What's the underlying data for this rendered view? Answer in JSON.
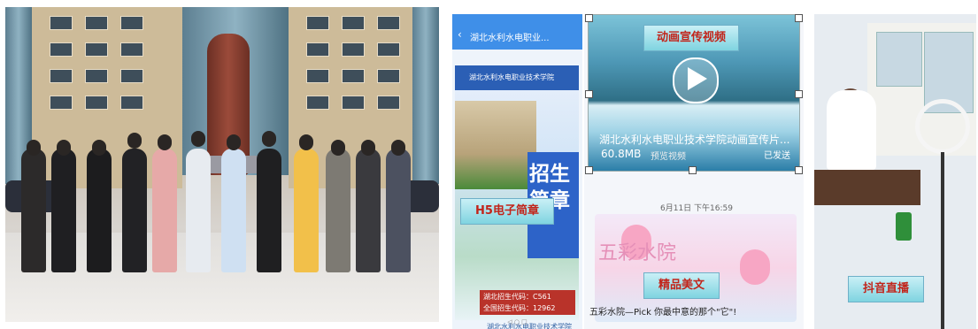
{
  "phone": {
    "title": "湖北水利水电职业...",
    "back_icon": "chevron-left-icon",
    "poster_header": "湖北水利水电职业技术学院",
    "poster_big_text": "招生简章",
    "codes_line1": "湖北招生代码：C561",
    "codes_line2": "全国招生代码：12962",
    "school_name": "湖北水利水电职业技术学院",
    "nav": "◁   ○   □"
  },
  "badges": {
    "h5": "H5电子简章",
    "video": "动画宣传视频",
    "article": "精品美文",
    "douyin": "抖音直播"
  },
  "video": {
    "title": "湖北水利水电职业技术学院动画宣传片...",
    "size": "60.8MB",
    "sub": "预览视频",
    "sent": "已发送"
  },
  "chat": {
    "date": "6月11日 下午16:59",
    "card_art_text": "五彩水院",
    "article_title": "五彩水院—Pick 你最中意的那个\"它\"!"
  },
  "colors": {
    "phone_bar": "#3f8fe8",
    "badge_text": "#c2241a",
    "badge_bg": "#7fd4e0"
  }
}
